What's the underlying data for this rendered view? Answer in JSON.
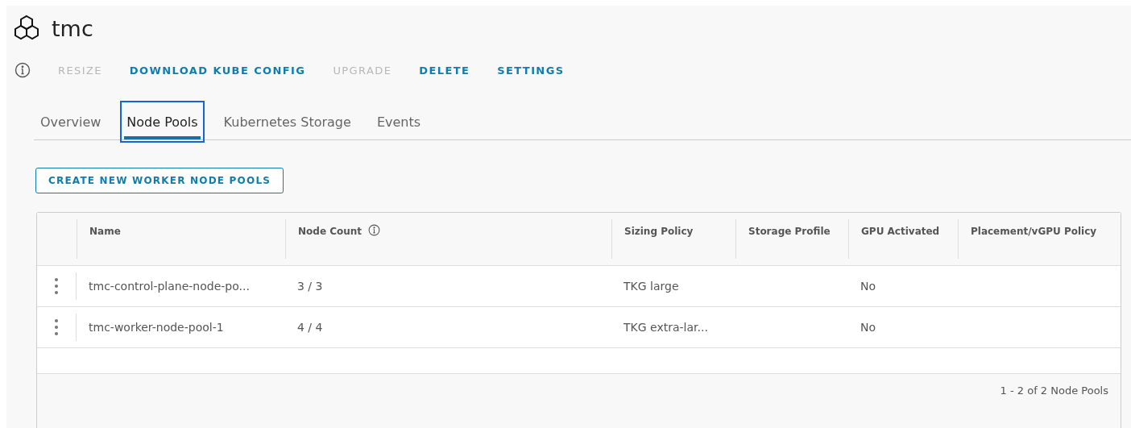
{
  "header": {
    "title": "tmc"
  },
  "actions": [
    {
      "label": "RESIZE",
      "disabled": true
    },
    {
      "label": "DOWNLOAD KUBE CONFIG",
      "disabled": false
    },
    {
      "label": "UPGRADE",
      "disabled": true
    },
    {
      "label": "DELETE",
      "disabled": false
    },
    {
      "label": "SETTINGS",
      "disabled": false
    }
  ],
  "tabs": [
    {
      "label": "Overview",
      "selected": false,
      "focused": false
    },
    {
      "label": "Node Pools",
      "selected": true,
      "focused": true
    },
    {
      "label": "Kubernetes Storage",
      "selected": false,
      "focused": false
    },
    {
      "label": "Events",
      "selected": false,
      "focused": false
    }
  ],
  "create_button": {
    "label": "CREATE NEW WORKER NODE POOLS"
  },
  "table": {
    "columns": [
      {
        "label": "Name",
        "info": false
      },
      {
        "label": "Node Count",
        "info": true
      },
      {
        "label": "Sizing Policy",
        "info": false
      },
      {
        "label": "Storage Profile",
        "info": false
      },
      {
        "label": "GPU Activated",
        "info": false
      },
      {
        "label": "Placement/vGPU Policy",
        "info": false
      }
    ],
    "rows": [
      [
        "tmc-control-plane-node-po...",
        "3 / 3",
        "TKG large",
        "",
        "No",
        ""
      ],
      [
        "tmc-worker-node-pool-1",
        "4 / 4",
        "TKG extra-lar...",
        "",
        "No",
        ""
      ]
    ],
    "footer": "1 - 2 of 2 Node Pools"
  }
}
